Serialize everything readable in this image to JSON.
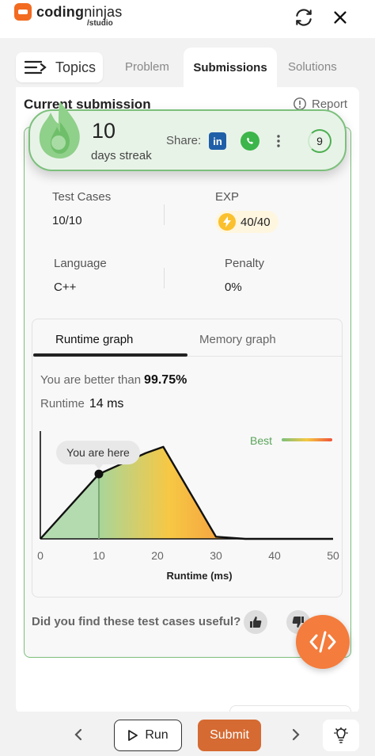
{
  "brand": {
    "name_bold": "coding",
    "name_light": "ninjas",
    "sub": "/studio"
  },
  "top_icons": {
    "refresh": "refresh-icon",
    "close": "close-icon"
  },
  "tabs": {
    "topics": "Topics",
    "problem": "Problem",
    "submissions": "Submissions",
    "solutions": "Solutions"
  },
  "submission": {
    "title": "Current submission",
    "report": "Report",
    "test_cases_label": "Test Cases",
    "test_cases_value": "10/10",
    "exp_label": "EXP",
    "exp_value": "40/40",
    "language_label": "Language",
    "language_value": "C++",
    "penalty_label": "Penalty",
    "penalty_value": "0%"
  },
  "streak": {
    "count": "10",
    "label": "days streak",
    "share_label": "Share:",
    "linkedin": "in",
    "badge": "9"
  },
  "graph": {
    "tab_runtime": "Runtime graph",
    "tab_memory": "Memory graph",
    "better_prefix": "You are better than",
    "better_value": "99.75%",
    "runtime_label": "Runtime",
    "runtime_value": "14 ms",
    "tooltip": "You are here",
    "legend_best": "Best",
    "xlabel": "Runtime (ms)"
  },
  "chart_data": {
    "type": "area",
    "xlabel": "Runtime (ms)",
    "ylabel": "",
    "x_ticks": [
      0,
      10,
      20,
      30,
      40,
      50
    ],
    "xlim": [
      0,
      50
    ],
    "ylim": [
      0,
      1
    ],
    "curve": {
      "x": [
        0,
        10,
        14,
        18,
        21,
        30,
        35,
        40,
        45,
        50
      ],
      "y": [
        0,
        0.62,
        0.72,
        0.82,
        0.88,
        0.02,
        0.0,
        0.0,
        0.0,
        0.0
      ]
    },
    "you_are_here": {
      "x": 10,
      "label": "You are here"
    },
    "legend": "Best",
    "gradient_colors": [
      "#a9d4a9",
      "#f5c842",
      "#f26b3a"
    ]
  },
  "feedback": {
    "question": "Did you find these test cases useful?"
  },
  "bottom": {
    "run": "Run",
    "submit": "Submit"
  },
  "colors": {
    "accent": "#d56a32",
    "success": "#4caf50",
    "brand": "#f26b21"
  }
}
